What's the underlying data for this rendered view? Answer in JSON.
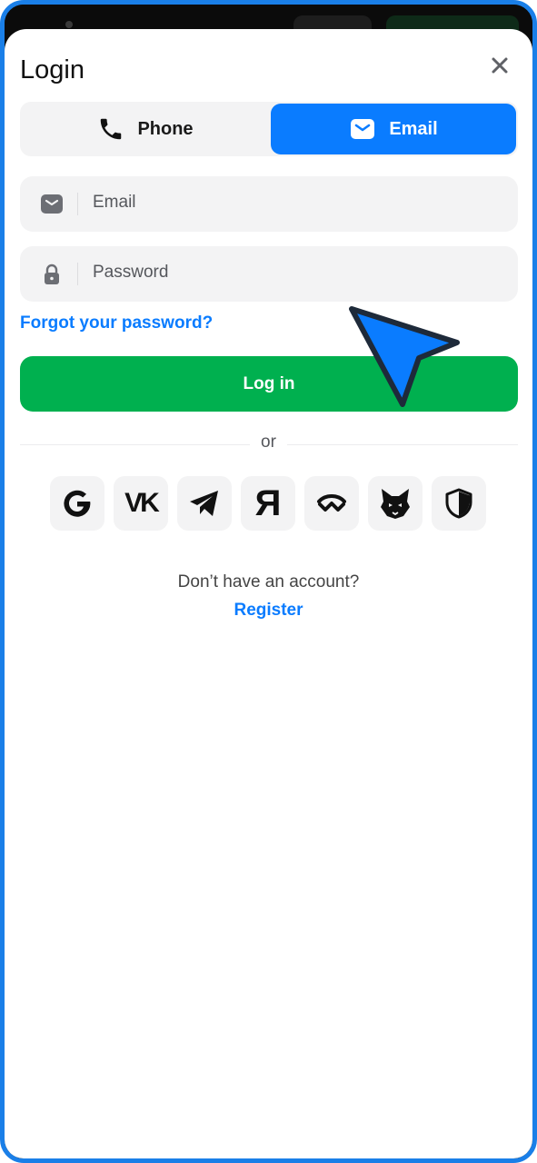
{
  "header": {
    "title": "Login"
  },
  "tabs": {
    "phone_label": "Phone",
    "email_label": "Email",
    "active": "Email"
  },
  "form": {
    "email_placeholder": "Email",
    "password_placeholder": "Password",
    "forgot_label": "Forgot your password?",
    "login_label": "Log in"
  },
  "divider": {
    "label": "or"
  },
  "social": {
    "items": [
      "google",
      "vk",
      "telegram",
      "yandex",
      "walletconnect",
      "metamask",
      "shield"
    ],
    "vk_label": "VK",
    "yandex_label": "Я"
  },
  "footer": {
    "prompt": "Don’t have an account?",
    "register_label": "Register"
  },
  "colors": {
    "accent": "#0a7cff",
    "primary_button": "#00b04f",
    "frame": "#1a7fe8"
  }
}
